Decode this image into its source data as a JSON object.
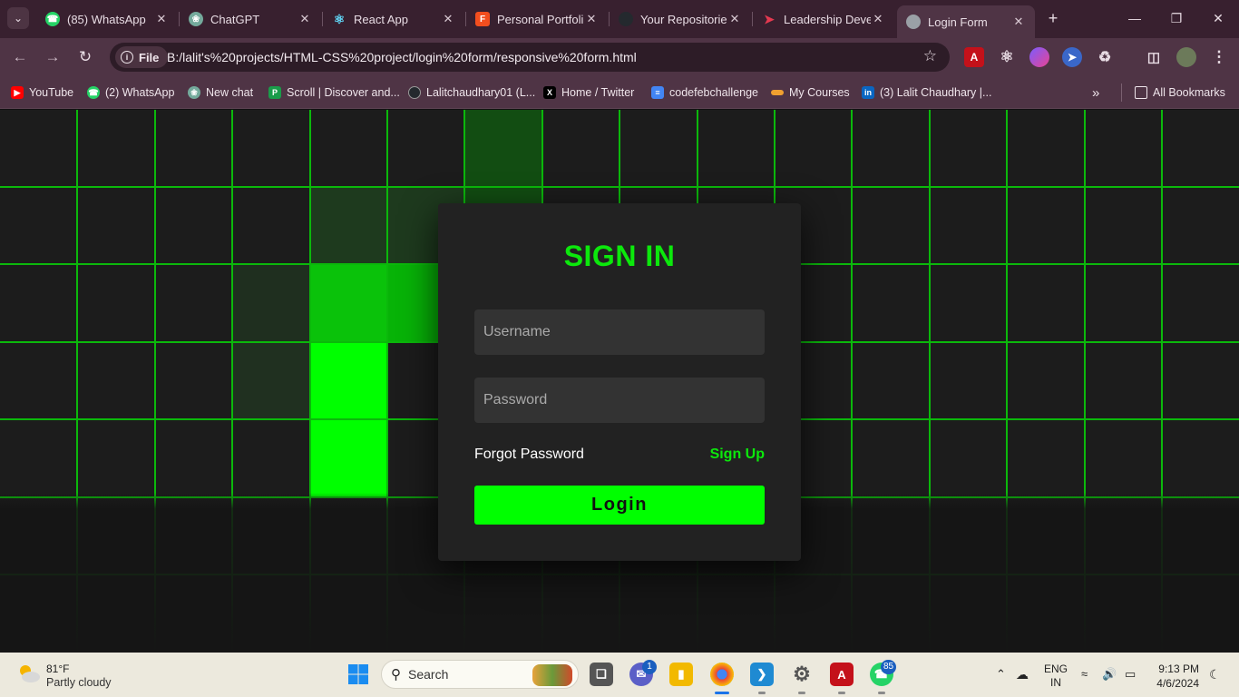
{
  "tabs": [
    {
      "title": "(85) WhatsApp",
      "icon": "whatsapp-icon",
      "color": "#25d366"
    },
    {
      "title": "ChatGPT",
      "icon": "chatgpt-icon",
      "color": "#74aa9c"
    },
    {
      "title": "React App",
      "icon": "react-icon",
      "color": "#61dafb"
    },
    {
      "title": "Personal Portfoli",
      "icon": "figma-icon",
      "color": "#f24e1e"
    },
    {
      "title": "Your Repositorie",
      "icon": "github-icon",
      "color": "#24292e"
    },
    {
      "title": "Leadership Deve",
      "icon": "coursera-icon",
      "color": "#e53950"
    },
    {
      "title": "Login Form",
      "icon": "globe-icon",
      "color": "#9aa0a6"
    }
  ],
  "address": {
    "chip": "File",
    "url": "B:/lalit's%20projects/HTML-CSS%20project/login%20form/responsive%20form.html"
  },
  "bookmarks": [
    {
      "label": "YouTube",
      "icon": "youtube-icon",
      "color": "#ff0000"
    },
    {
      "label": "(2) WhatsApp",
      "icon": "whatsapp-icon",
      "color": "#25d366"
    },
    {
      "label": "New chat",
      "icon": "chatgpt-icon",
      "color": "#74aa9c"
    },
    {
      "label": "Scroll | Discover and...",
      "icon": "scroll-icon",
      "color": "#1a9c4a"
    },
    {
      "label": "Lalitchaudhary01 (L...",
      "icon": "github-icon",
      "color": "#24292e"
    },
    {
      "label": "Home / Twitter",
      "icon": "x-icon",
      "color": "#000000"
    },
    {
      "label": "codefebchallenge",
      "icon": "docs-icon",
      "color": "#4285f4"
    },
    {
      "label": "My Courses",
      "icon": "courses-icon",
      "color": "#f0a030"
    },
    {
      "label": "(3) Lalit Chaudhary |...",
      "icon": "linkedin-icon",
      "color": "#0a66c2"
    }
  ],
  "all_bookmarks": "All Bookmarks",
  "form": {
    "title": "SIGN IN",
    "username_placeholder": "Username",
    "password_placeholder": "Password",
    "forgot": "Forgot Password",
    "signup": "Sign Up",
    "login": "Login"
  },
  "colors": {
    "accent": "#00ff00",
    "grid": "#0bb80b",
    "card": "#222222",
    "page": "#1c1c1c"
  },
  "taskbar": {
    "weather_temp": "81°F",
    "weather_desc": "Partly cloudy",
    "search": "Search",
    "teams_badge": "1",
    "whatsapp_badge": "85",
    "lang_top": "ENG",
    "lang_bottom": "IN",
    "time": "9:13 PM",
    "date": "4/6/2024"
  }
}
